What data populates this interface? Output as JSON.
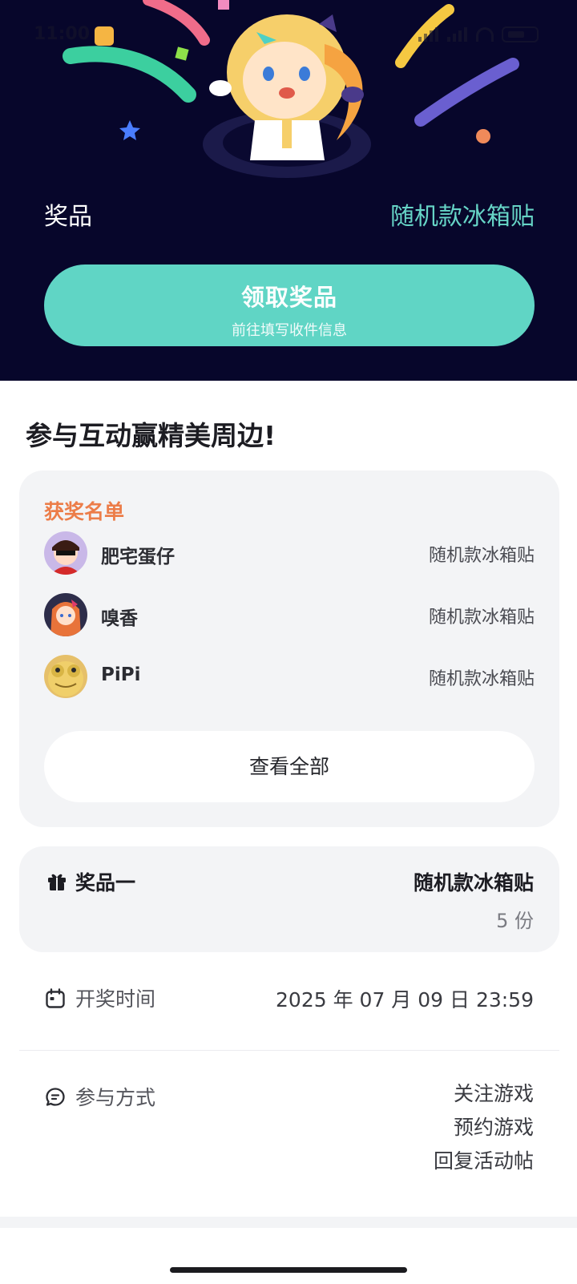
{
  "status_bar": {
    "time": "11:00"
  },
  "hero": {
    "prize_label": "奖品",
    "prize_value": "随机款冰箱贴",
    "claim_button": {
      "title": "领取奖品",
      "subtitle": "前往填写收件信息"
    }
  },
  "section_title": "参与互动赢精美周边!",
  "winners": {
    "title": "获奖名单",
    "list": [
      {
        "name": "肥宅蛋仔",
        "prize": "随机款冰箱贴"
      },
      {
        "name": "嗅香",
        "prize": "随机款冰箱贴"
      },
      {
        "name": "PiPi",
        "prize": "随机款冰箱贴"
      }
    ],
    "view_all": "查看全部"
  },
  "prize_detail": {
    "name": "奖品一",
    "item": "随机款冰箱贴",
    "count": "5 份",
    "icon": "gift-icon"
  },
  "draw_time": {
    "label": "开奖时间",
    "value": "2025 年 07 月 09 日 23:59",
    "icon": "calendar-icon"
  },
  "participation": {
    "label": "参与方式",
    "methods": [
      "关注游戏",
      "预约游戏",
      "回复活动帖"
    ],
    "icon": "chat-icon"
  },
  "colors": {
    "hero_bg": "#07062b",
    "accent": "#60d5c5",
    "winners_title": "#ec7d49",
    "card_bg": "#f3f4f6"
  }
}
